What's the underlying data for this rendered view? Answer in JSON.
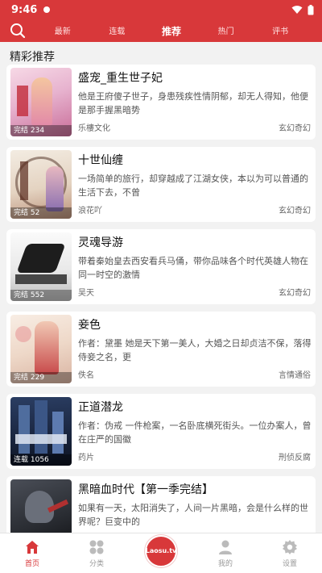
{
  "status_bar": {
    "time": "9:46"
  },
  "nav": {
    "tabs": [
      {
        "label": "最新"
      },
      {
        "label": "连载"
      },
      {
        "label": "推荐"
      },
      {
        "label": "热门"
      },
      {
        "label": "评书"
      }
    ],
    "active_tab": 2
  },
  "section_title": "精彩推荐",
  "books": [
    {
      "title": "盛宠_重生世子妃",
      "desc": "他是王府傻子世子，身患残疾性情阴郁，却无人得知，他便是那手握黑暗势",
      "author": "乐樓文化",
      "genre": "玄幻奇幻",
      "badge": "完结 234"
    },
    {
      "title": "十世仙缠",
      "desc": "一场简单的旅行，却穿越成了江湖女侠，本以为可以普通的生活下去，不曾",
      "author": "浪花吖",
      "genre": "玄幻奇幻",
      "badge": "完结 52"
    },
    {
      "title": "灵魂导游",
      "desc": "带着秦始皇去西安看兵马俑，带你品味各个时代英雄人物在同一时空的激情",
      "author": "吴天",
      "genre": "玄幻奇幻",
      "badge": "完结 552"
    },
    {
      "title": "妾色",
      "desc": "作者：黛墨 她是天下第一美人，大婚之日却贞洁不保，落得侍妾之名，更",
      "author": "佚名",
      "genre": "言情通俗",
      "badge": "完结 229"
    },
    {
      "title": "正道潜龙",
      "desc": "作者：伪戒 一件枪案，一名卧底横死街头。一位办案人，曾在庄严的国徽",
      "author": "药片",
      "genre": "刑侦反腐",
      "badge": "连载 1056"
    },
    {
      "title": "黑暗血时代【第一季完结】",
      "desc": "如果有一天，太阳消失了，人间一片黑暗，会是什么样的世界呢？巨变中的",
      "author": "",
      "genre": "",
      "badge": ""
    }
  ],
  "bottom_nav": [
    {
      "label": "首页",
      "icon": "home-icon"
    },
    {
      "label": "分类",
      "icon": "grid-icon"
    },
    {
      "label": "Laosu.tv",
      "icon": "logo"
    },
    {
      "label": "我的",
      "icon": "user-icon"
    },
    {
      "label": "设置",
      "icon": "gear-icon"
    }
  ],
  "colors": {
    "primary": "#d8383a",
    "background": "#f2f2f2"
  }
}
